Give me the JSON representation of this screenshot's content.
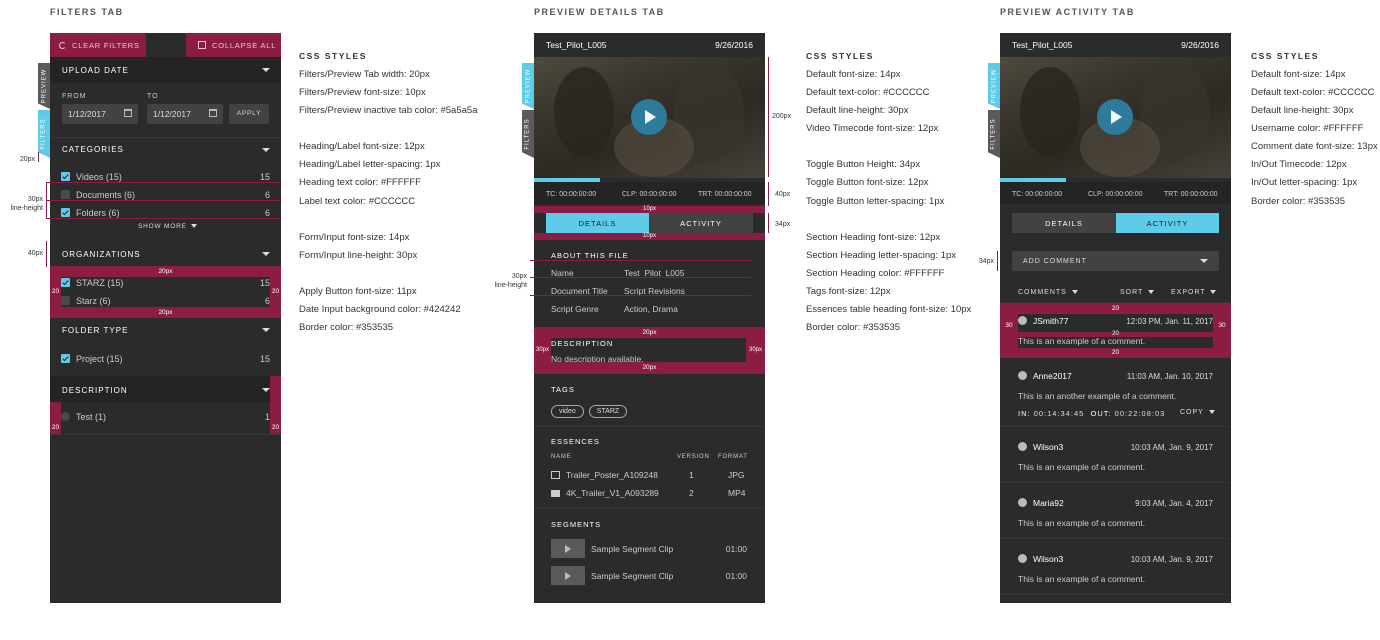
{
  "titles": {
    "filters": "FILTERS TAB",
    "details": "PREVIEW DETAILS TAB",
    "activity": "PREVIEW ACTIVITY TAB"
  },
  "filters": {
    "clear_label": "CLEAR FILTERS",
    "collapse_label": "COLLAPSE ALL",
    "tab_preview": "PREVIEW",
    "tab_filters": "FILTERS",
    "upload_date": "UPLOAD DATE",
    "from_label": "FROM",
    "to_label": "TO",
    "from_value": "1/12/2017",
    "to_value": "1/12/2017",
    "apply_label": "APPLY",
    "categories": "CATEGORIES",
    "cat_items": [
      {
        "label": "Videos (15)",
        "count": "15"
      },
      {
        "label": "Documents (6)",
        "count": "6"
      },
      {
        "label": "Folders (6)",
        "count": "6"
      }
    ],
    "show_more": "SHOW MORE",
    "organizations": "ORGANIZATIONS",
    "org_items": [
      {
        "label": "STARZ (15)",
        "count": "15"
      },
      {
        "label": "Starz (6)",
        "count": "6"
      }
    ],
    "folder_type": "FOLDER TYPE",
    "folder_item": {
      "label": "Project (15)",
      "count": "15"
    },
    "description": "DESCRIPTION",
    "desc_item": {
      "label": "Test (1)",
      "count": "1"
    }
  },
  "filters_notes": {
    "head": "CSS STYLES",
    "lines": [
      "Filters/Preview Tab width: 20px",
      "Filters/Preview font-size: 10px",
      "Filters/Preview inactive tab color: #5a5a5a",
      "Heading/Label font-size: 12px",
      "Heading/Label letter-spacing: 1px",
      "Heading text color: #FFFFFF",
      "Label text color: #CCCCCC",
      "Form/Input font-size: 14px",
      "Form/Input line-height: 30px",
      "Apply Button font-size: 11px",
      "Date Input background color: #424242",
      "Border color: #353535"
    ]
  },
  "filters_dims": {
    "d20px": "20px",
    "d30px": "30px",
    "d_lineheight": "line-height",
    "d40px": "40px",
    "band_20px": "20px",
    "side_20": "20"
  },
  "details": {
    "file_name": "Test_Pilot_L005",
    "date": "9/26/2016",
    "tab_preview": "PREVIEW",
    "tab_filters": "FILTERS",
    "tc": "TC: 00:00:00:00",
    "clp": "CLP: 00:00:00:00",
    "trt": "TRT: 00:00:00:00",
    "btn_details": "DETAILS",
    "btn_activity": "ACTIVITY",
    "about": "ABOUT THIS FILE",
    "rows": [
      {
        "k": "Name",
        "v": "Test_Pilot_L005"
      },
      {
        "k": "Document Title",
        "v": "Script Revisions"
      },
      {
        "k": "Script Genre",
        "v": "Action, Drama"
      }
    ],
    "description": "DESCRIPTION",
    "desc_text": "No description available.",
    "tags": "TAGS",
    "tag_items": [
      "video",
      "STARZ"
    ],
    "essences": "ESSENCES",
    "ess_cols": {
      "name": "NAME",
      "version": "VERSION",
      "format": "FORMAT"
    },
    "ess_rows": [
      {
        "name": "Trailer_Poster_A109248",
        "version": "1",
        "format": "JPG"
      },
      {
        "name": "4K_Trailer_V1_A093289",
        "version": "2",
        "format": "MP4"
      }
    ],
    "segments": "SEGMENTS",
    "seg_rows": [
      {
        "name": "Sample Segment Clip",
        "time": "01:00"
      },
      {
        "name": "Sample Segment Clip",
        "time": "01:00"
      }
    ]
  },
  "details_dims": {
    "d200": "200px",
    "d40": "40px",
    "d10a": "10px",
    "d10b": "10px",
    "d34": "34px",
    "d30": "30px",
    "d_lineheight": "line-height",
    "d20a": "20px",
    "d20b": "20px",
    "d30l": "30px",
    "d30r": "30px"
  },
  "details_notes": {
    "head": "CSS STYLES",
    "lines": [
      "Default font-size: 14px",
      "Default text-color: #CCCCCC",
      "Default line-height: 30px",
      "Video Timecode font-size: 12px",
      "Toggle Button Height: 34px",
      "Toggle Button font-size: 12px",
      "Toggle Button letter-spacing: 1px",
      "Section Heading font-size: 12px",
      "Section Heading letter-spacing: 1px",
      "Section Heading color: #FFFFFF",
      "Tags font-size: 12px",
      "Essences table heading font-size: 10px",
      "Border color: #353535"
    ]
  },
  "activity": {
    "file_name": "Test_Pilot_L005",
    "date": "9/26/2016",
    "tab_preview": "PREVIEW",
    "tab_filters": "FILTERS",
    "tc": "TC: 00:00:00:00",
    "clp": "CLP: 00:00:00:00",
    "trt": "TRT: 00:00:00:00",
    "btn_details": "DETAILS",
    "btn_activity": "ACTIVITY",
    "add_comment": "ADD COMMENT",
    "comments": "COMMENTS",
    "sort": "SORT",
    "export": "EXPORT",
    "items": [
      {
        "user": "JSmith77",
        "date": "12:03 PM, Jan. 11, 2017",
        "text": "This is an example of a comment."
      },
      {
        "user": "Anne2017",
        "date": "11:03 AM, Jan. 10, 2017",
        "text": "This is an another example of a comment."
      },
      {
        "user": "Wilson3",
        "date": "10:03 AM, Jan. 9, 2017",
        "text": "This is an example of a comment."
      },
      {
        "user": "Maria92",
        "date": "9:03 AM, Jan. 4, 2017",
        "text": "This is an example of a comment."
      },
      {
        "user": "Wilson3",
        "date": "10:03 AM, Jan. 9, 2017",
        "text": "This is an example of a comment."
      }
    ],
    "inout": {
      "in_label": "IN:",
      "in_value": "00:14:34:45",
      "out_label": "OUT:",
      "out_value": "00:22:08:03",
      "copy": "COPY"
    }
  },
  "activity_dims": {
    "d34": "34px",
    "t20": "20",
    "b20": "20",
    "l30": "30",
    "r30": "30",
    "m20": "20"
  },
  "activity_notes": {
    "head": "CSS STYLES",
    "lines": [
      "Default font-size: 14px",
      "Default text-color: #CCCCCC",
      "Default line-height: 30px",
      "Username color: #FFFFFF",
      "Comment date font-size: 13px",
      "In/Out Timecode: 12px",
      "In/Out letter-spacing: 1px",
      "Border color: #353535"
    ]
  },
  "colors": {
    "accent": "#5ecbe9",
    "highlight": "#8b1d44",
    "panel": "#2b2b2b",
    "border": "#353535"
  }
}
